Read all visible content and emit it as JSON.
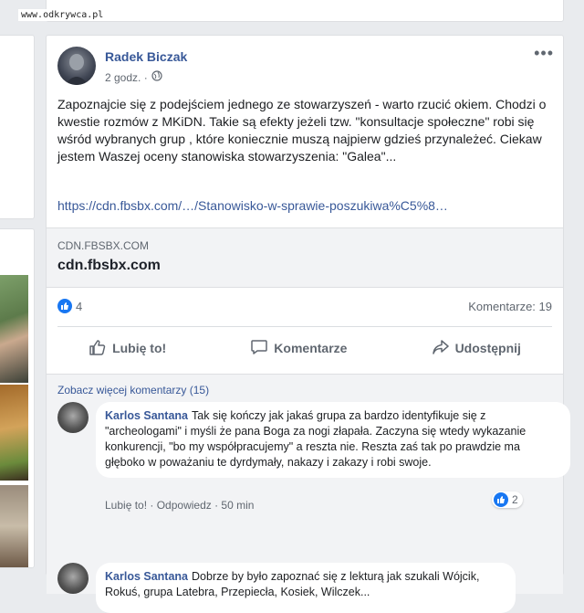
{
  "watermark": "www.odkrywca.pl",
  "post": {
    "author": "Radek Biczak",
    "time": "2 godz. ·",
    "more_icon": "•••",
    "text": "Zapoznajcie się z podejściem jednego ze stowarzyszeń - warto rzucić okiem. Chodzi o kwestie rozmów z MKiDN. Takie są efekty jeżeli tzw. \"konsultacje społeczne\" robi się wśród wybranych grup , które koniecznie muszą najpierw gdzieś przynależeć. Ciekaw jestem Waszej oceny stanowiska stowarzyszenia: \"Galea\"...",
    "link": "https://cdn.fbsbx.com/…/Stanowisko-w-sprawie-poszukiwa%C5%8…",
    "preview": {
      "domain": "CDN.FBSBX.COM",
      "title": "cdn.fbsbx.com"
    },
    "reactions_count": "4",
    "comments_count": "Komentarze: 19"
  },
  "actions": {
    "like": "Lubię to!",
    "comment": "Komentarze",
    "share": "Udostępnij"
  },
  "comments_section": {
    "see_more": "Zobacz więcej komentarzy (15)",
    "items": [
      {
        "author": "Karlos Santana",
        "text": "Tak się kończy jak jakaś grupa za bardzo identyfikuje się z \"archeologami\" i myśli że pana Boga za nogi złapała. Zaczyna się wtedy wykazanie konkurencji, \"bo my współpracujemy\" a reszta nie. Reszta zaś tak po prawdzie ma głęboko w poważaniu te dyrdymały, nakazy i zakazy i robi swoje.",
        "like": "Lubię to!",
        "sep": " · ",
        "reply": "Odpowiedz",
        "time": " · 50 min",
        "reactions": "2"
      },
      {
        "author": "Karlos Santana",
        "text": "Dobrze by było zapoznać się z lekturą jak szukali Wójcik, Rokuś, grupa Latebra, Przepiecła, Kosiek, Wilczek..."
      }
    ]
  },
  "colors": {
    "link": "#385898",
    "like_blue": "#1877f2",
    "bg": "#e9ebee"
  }
}
